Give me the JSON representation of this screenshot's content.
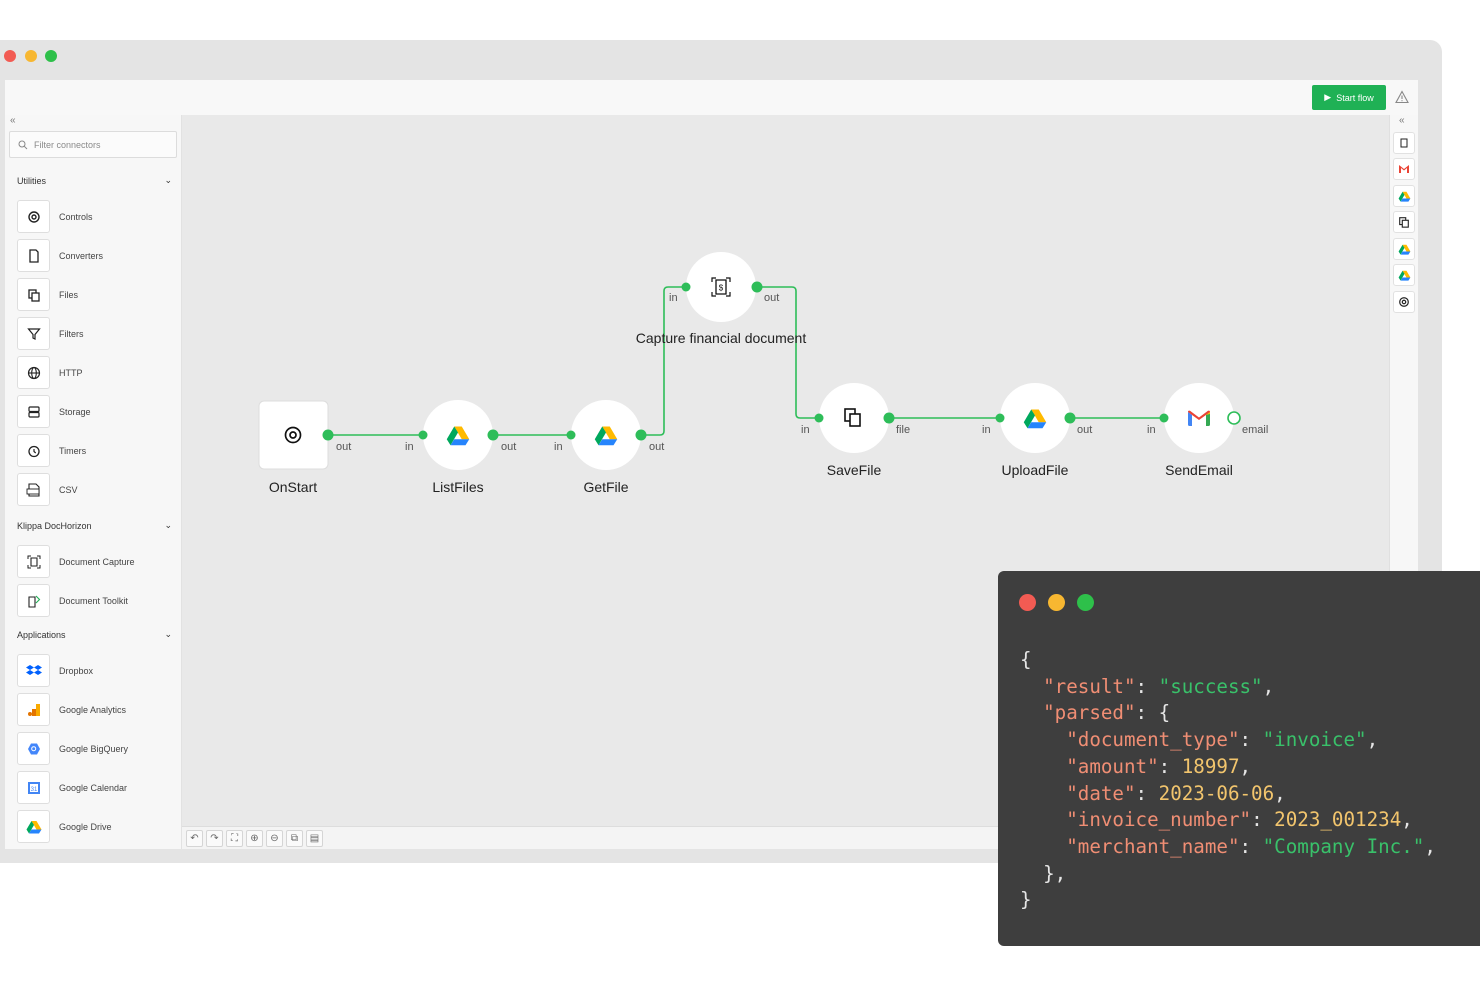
{
  "window": {
    "dots": [
      "#f25b53",
      "#f7b731",
      "#2ec04a"
    ]
  },
  "toolbar": {
    "start_label": "Start flow",
    "start_color": "#1fb155"
  },
  "sidebar": {
    "collapse": "«",
    "filter_placeholder": "Filter connectors",
    "sections": [
      {
        "title": "Utilities",
        "items": [
          {
            "label": "Controls",
            "icon": "gear-icon"
          },
          {
            "label": "Converters",
            "icon": "file-convert-icon"
          },
          {
            "label": "Files",
            "icon": "files-icon"
          },
          {
            "label": "Filters",
            "icon": "filter-icon"
          },
          {
            "label": "HTTP",
            "icon": "globe-icon"
          },
          {
            "label": "Storage",
            "icon": "storage-icon"
          },
          {
            "label": "Timers",
            "icon": "alarm-icon"
          },
          {
            "label": "CSV",
            "icon": "csv-icon"
          }
        ]
      },
      {
        "title": "Klippa DocHorizon",
        "items": [
          {
            "label": "Document Capture",
            "icon": "document-capture-icon"
          },
          {
            "label": "Document Toolkit",
            "icon": "document-toolkit-icon"
          }
        ]
      },
      {
        "title": "Applications",
        "items": [
          {
            "label": "Dropbox",
            "icon": "dropbox-icon"
          },
          {
            "label": "Google Analytics",
            "icon": "google-analytics-icon"
          },
          {
            "label": "Google BigQuery",
            "icon": "google-bigquery-icon"
          },
          {
            "label": "Google Calendar",
            "icon": "google-calendar-icon"
          },
          {
            "label": "Google Drive",
            "icon": "google-drive-icon"
          }
        ]
      }
    ]
  },
  "flow": {
    "nodes": [
      {
        "label": "OnStart",
        "icon": "gear-icon",
        "ports": [
          "out"
        ]
      },
      {
        "label": "ListFiles",
        "icon": "google-drive-icon",
        "ports": [
          "in",
          "out"
        ]
      },
      {
        "label": "GetFile",
        "icon": "google-drive-icon",
        "ports": [
          "in",
          "out"
        ]
      },
      {
        "label": "Capture financial document",
        "icon": "financial-document-icon",
        "ports": [
          "in",
          "out"
        ]
      },
      {
        "label": "SaveFile",
        "icon": "files-icon",
        "ports": [
          "in",
          "file"
        ]
      },
      {
        "label": "UploadFile",
        "icon": "google-drive-icon",
        "ports": [
          "in",
          "out"
        ]
      },
      {
        "label": "SendEmail",
        "icon": "gmail-icon",
        "ports": [
          "in",
          "email"
        ]
      }
    ],
    "edge_color": "#2ebd59"
  },
  "rightbar": {
    "collapse": "«",
    "icons": [
      "financial-document-icon",
      "gmail-icon",
      "google-drive-icon",
      "files-icon",
      "google-drive-icon",
      "google-drive-icon",
      "gear-icon"
    ]
  },
  "code": {
    "open": "{",
    "result_key": "\"result\"",
    "result_val": "\"success\"",
    "parsed_key": "\"parsed\"",
    "doc_type_key": "\"document_type\"",
    "doc_type_val": "\"invoice\"",
    "amount_key": "\"amount\"",
    "amount_val": "18997",
    "date_key": "\"date\"",
    "date_val": "2023-06-06",
    "inv_key": "\"invoice_number\"",
    "inv_val": "2023_001234",
    "merchant_key": "\"merchant_name\"",
    "merchant_val": "\"Company Inc.\"",
    "inner_close": "},",
    "close": "}"
  }
}
